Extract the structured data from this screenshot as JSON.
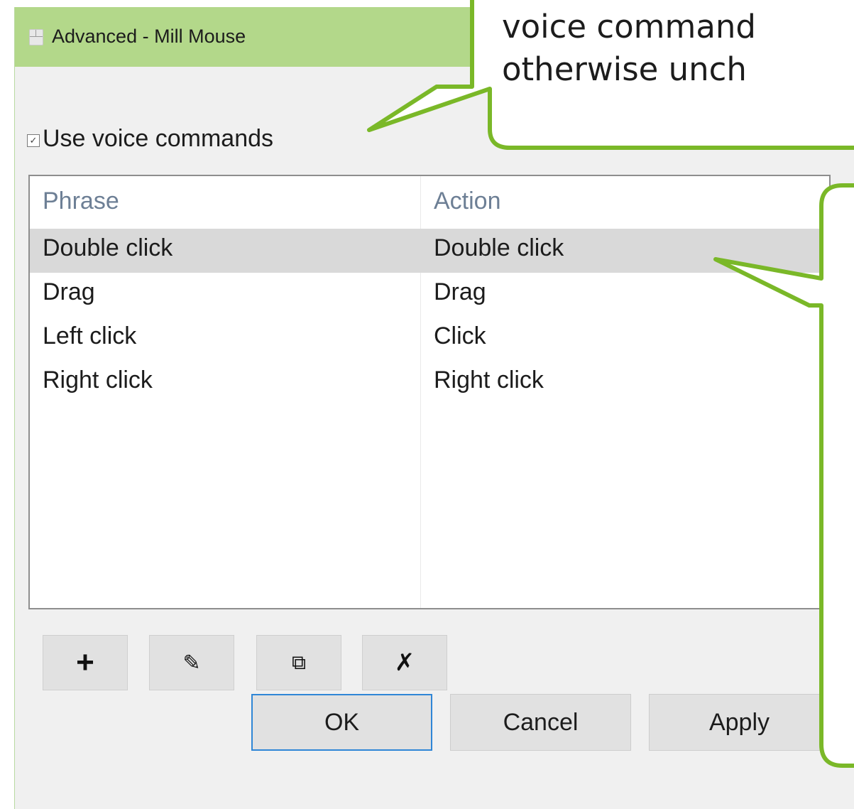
{
  "window": {
    "title": "Advanced - Mill Mouse"
  },
  "voice": {
    "checked": true,
    "check_glyph": "✓",
    "label": "Use voice commands"
  },
  "table": {
    "columns": [
      "Phrase",
      "Action"
    ],
    "rows": [
      {
        "phrase": "Double click",
        "action": "Double click",
        "selected": true
      },
      {
        "phrase": "Drag",
        "action": "Drag",
        "selected": false
      },
      {
        "phrase": "Left click",
        "action": "Click",
        "selected": false
      },
      {
        "phrase": "Right click",
        "action": "Right click",
        "selected": false
      }
    ]
  },
  "toolbar": {
    "add": "+",
    "edit": "✎",
    "copy": "⧉",
    "delete": "✗"
  },
  "buttons": {
    "ok": "OK",
    "cancel": "Cancel",
    "apply": "Apply"
  },
  "callout_top": {
    "line1": "voice command",
    "line2": "otherwise unch"
  },
  "colors": {
    "titlebar": "#b3d88a",
    "callout_border": "#7ab828",
    "selection": "#d9d9d9",
    "default_button_border": "#2f86d6"
  }
}
